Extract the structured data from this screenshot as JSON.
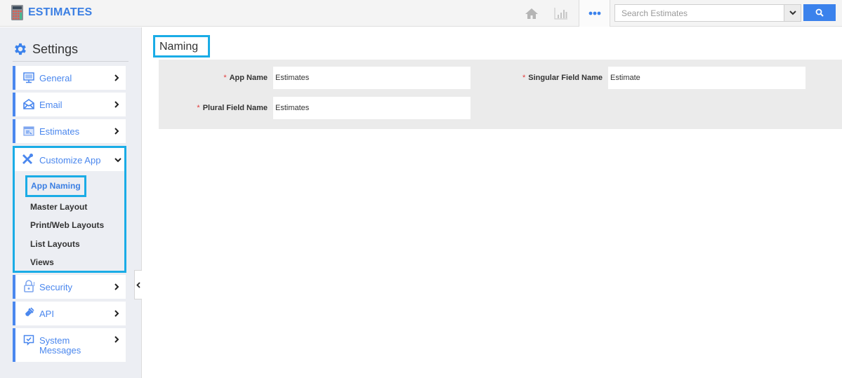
{
  "app": {
    "title": "ESTIMATES",
    "brand_color": "#3b7fe3"
  },
  "topbar": {
    "icons": [
      "home-icon",
      "chart-icon",
      "more-icon"
    ],
    "search": {
      "placeholder": "Search Estimates",
      "value": ""
    }
  },
  "sidebar": {
    "title": "Settings",
    "items": [
      {
        "label": "General",
        "icon": "monitor-icon"
      },
      {
        "label": "Email",
        "icon": "envelope-icon"
      },
      {
        "label": "Estimates",
        "icon": "window-icon"
      },
      {
        "label": "Customize App",
        "icon": "tools-icon",
        "expanded": true,
        "children": [
          {
            "label": "App Naming",
            "active": true
          },
          {
            "label": "Master Layout"
          },
          {
            "label": "Print/Web Layouts"
          },
          {
            "label": "List Layouts"
          },
          {
            "label": "Views"
          }
        ]
      },
      {
        "label": "Security",
        "icon": "lock-icon"
      },
      {
        "label": "API",
        "icon": "plug-icon"
      },
      {
        "label": "System Messages",
        "icon": "message-check-icon"
      }
    ]
  },
  "main": {
    "section_title": "Naming",
    "fields": [
      {
        "label": "App Name",
        "required": true,
        "value": "Estimates"
      },
      {
        "label": "Singular Field Name",
        "required": true,
        "value": "Estimate"
      },
      {
        "label": "Plural Field Name",
        "required": true,
        "value": "Estimates"
      }
    ],
    "required_marker": "*"
  },
  "colors": {
    "accent": "#4a87ee",
    "highlight": "#1aace6",
    "required": "#e23b3b",
    "search_button": "#3b82ec"
  }
}
